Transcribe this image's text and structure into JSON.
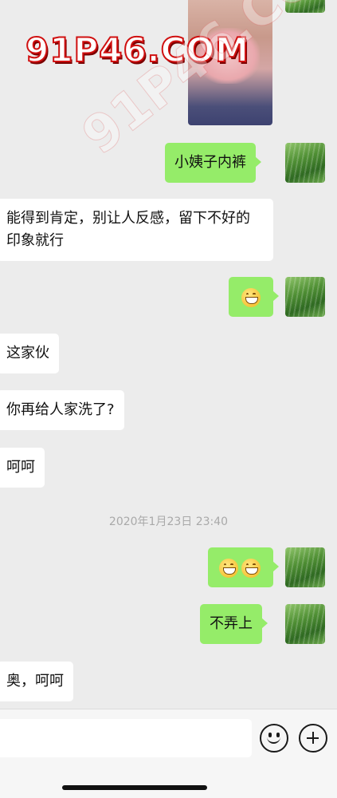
{
  "messages": [
    {
      "side": "out",
      "type": "image"
    },
    {
      "side": "out",
      "type": "text",
      "text": "小姨子内裤"
    },
    {
      "side": "in",
      "type": "text",
      "text": "能得到肯定，别让人反感，留下不好的印象就行"
    },
    {
      "side": "out",
      "type": "emoji",
      "emoji": [
        "grin-emoji"
      ]
    },
    {
      "side": "in",
      "type": "text",
      "text": "这家伙"
    },
    {
      "side": "in",
      "type": "text",
      "text": "你再给人家洗了?"
    },
    {
      "side": "in",
      "type": "text",
      "text": "呵呵"
    },
    {
      "side": "out",
      "type": "emoji",
      "emoji": [
        "grin-emoji",
        "grin-emoji"
      ]
    },
    {
      "side": "out",
      "type": "text",
      "text": "不弄上"
    },
    {
      "side": "in",
      "type": "text",
      "text": "奥，呵呵"
    }
  ],
  "timestamp": "2020年1月23日 23:40",
  "watermark": "91P46.COM",
  "input_bar": {
    "input_value": "",
    "emoji_icon": "smile-face-icon",
    "more_icon": "plus-circle-icon"
  },
  "colors": {
    "background": "#ececec",
    "outgoing_bubble": "#95ec69",
    "incoming_bubble": "#ffffff",
    "timestamp_text": "#a9a9a9"
  }
}
